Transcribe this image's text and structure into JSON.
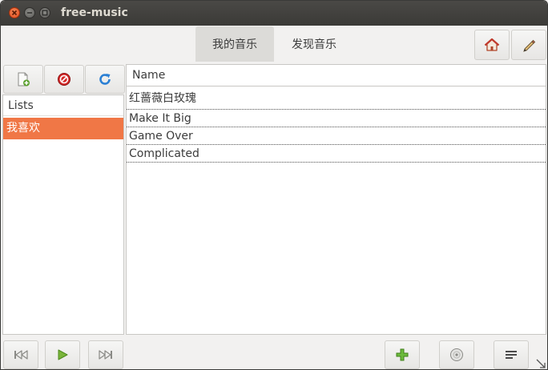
{
  "window": {
    "title": "free-music"
  },
  "tabs": [
    {
      "label": "我的音乐",
      "active": true
    },
    {
      "label": "发现音乐",
      "active": false
    }
  ],
  "header_icons": [
    "home-icon",
    "pencil-icon"
  ],
  "sidebar": {
    "toolbar_icons": [
      "new-document-icon",
      "delete-icon",
      "refresh-icon"
    ],
    "header": "Lists",
    "items": [
      {
        "label": "我喜欢",
        "selected": true
      }
    ]
  },
  "songs": {
    "column": "Name",
    "rows": [
      "红蔷薇白玫瑰",
      "Make It Big",
      "Game Over",
      "Complicated"
    ]
  },
  "bottom_bar_icons": [
    "previous-icon",
    "play-icon",
    "next-icon",
    "add-icon",
    "disc-icon",
    "menu-lines-icon"
  ],
  "colors": {
    "selection": "#f07746",
    "titlebar": "#3c3b37",
    "close_button": "#e8521f",
    "play_green": "#7ab53a"
  }
}
